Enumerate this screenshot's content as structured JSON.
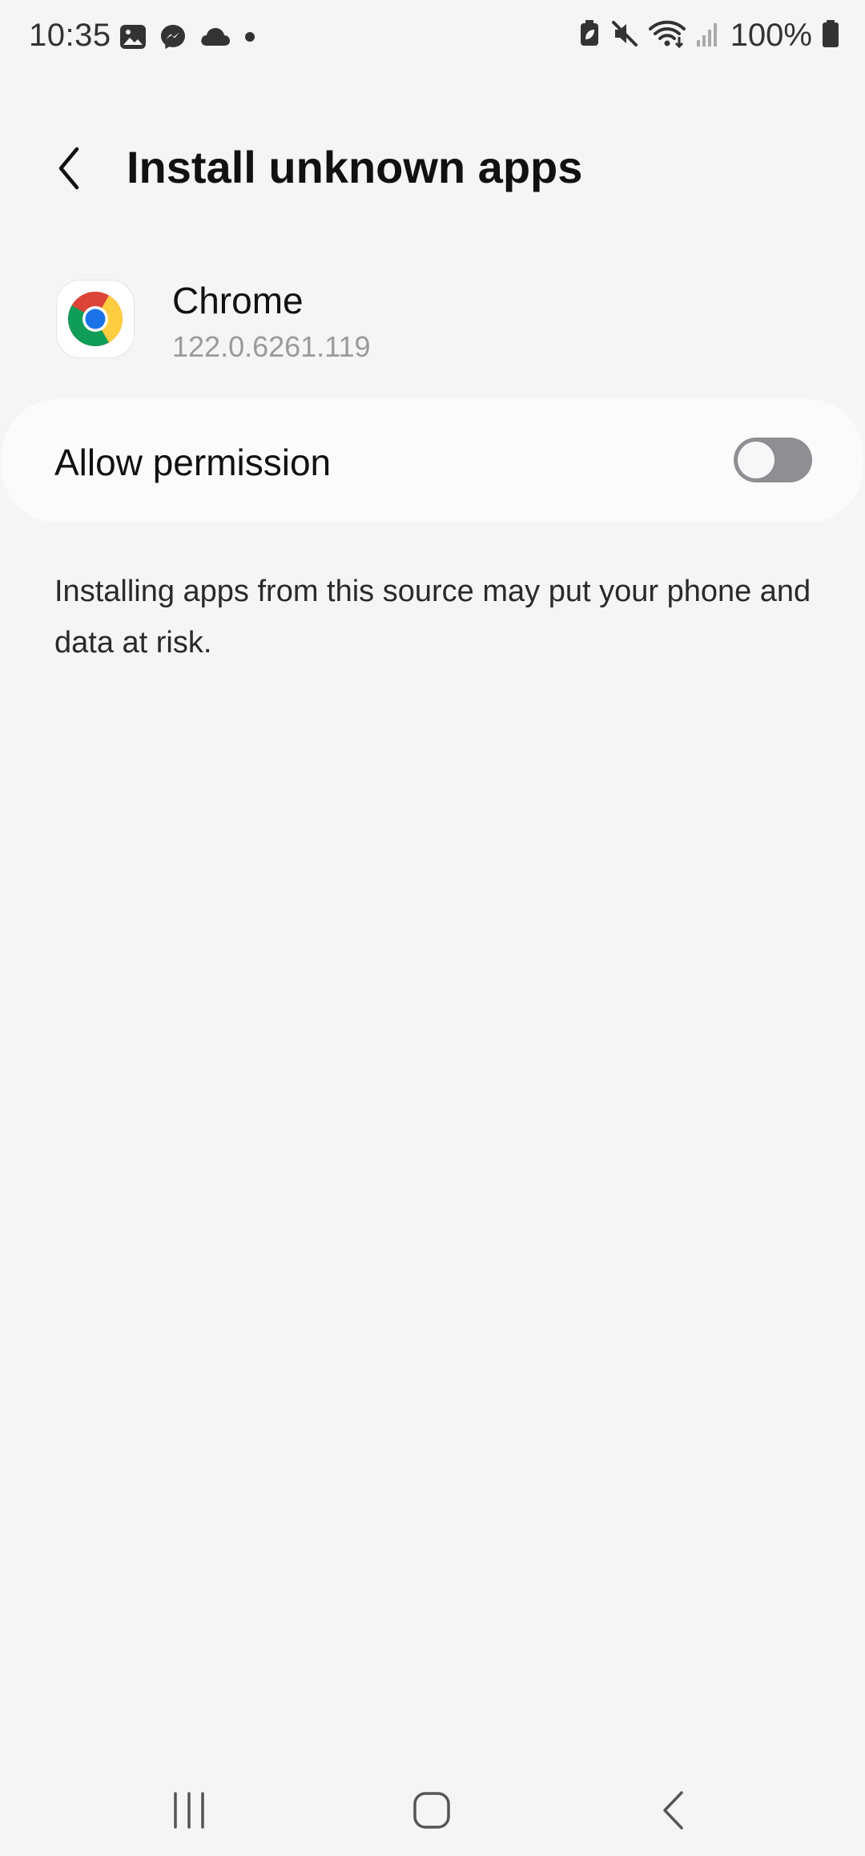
{
  "status_bar": {
    "time": "10:35",
    "battery": "100%",
    "left_icons": [
      "gallery-icon",
      "messenger-icon",
      "cloud-icon",
      "dot-icon"
    ],
    "right_icons": [
      "battery-saver-icon",
      "mute-icon",
      "wifi-icon",
      "signal-icon",
      "battery-icon"
    ]
  },
  "header": {
    "title": "Install unknown apps",
    "back_icon": "chevron-left-icon"
  },
  "app": {
    "name": "Chrome",
    "version": "122.0.6261.119",
    "icon": "chrome-icon"
  },
  "permission": {
    "label": "Allow permission",
    "enabled": false
  },
  "warning": {
    "text": "Installing apps from this source may put your phone and data at risk."
  },
  "nav_bar": {
    "icons": [
      "recents-icon",
      "home-icon",
      "back-icon"
    ]
  }
}
